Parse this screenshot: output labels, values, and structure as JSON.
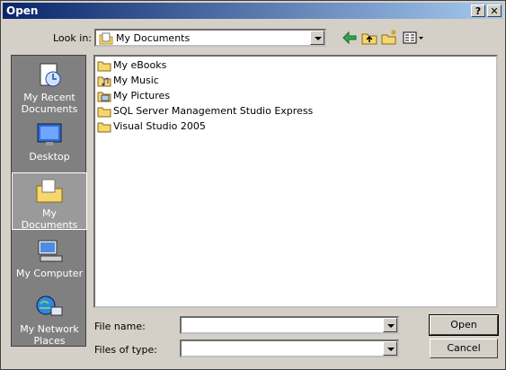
{
  "window": {
    "title": "Open"
  },
  "titlebar": {
    "help": "?",
    "close": "✕"
  },
  "lookin": {
    "label": "Look in:",
    "value": "My Documents",
    "toolbar_icons": [
      "back-arrow-icon",
      "up-folder-icon",
      "new-folder-icon",
      "views-menu-icon"
    ]
  },
  "places": [
    {
      "label": "My Recent Documents",
      "icon": "recent-documents-icon",
      "selected": false
    },
    {
      "label": "Desktop",
      "icon": "desktop-icon",
      "selected": false
    },
    {
      "label": "My Documents",
      "icon": "my-documents-icon",
      "selected": true
    },
    {
      "label": "My Computer",
      "icon": "my-computer-icon",
      "selected": false
    },
    {
      "label": "My Network Places",
      "icon": "network-places-icon",
      "selected": false
    }
  ],
  "files": [
    {
      "name": "My eBooks",
      "icon": "folder-icon"
    },
    {
      "name": "My Music",
      "icon": "music-folder-icon"
    },
    {
      "name": "My Pictures",
      "icon": "pictures-folder-icon"
    },
    {
      "name": "SQL Server Management Studio Express",
      "icon": "folder-icon"
    },
    {
      "name": "Visual Studio 2005",
      "icon": "folder-icon"
    }
  ],
  "bottom": {
    "file_name_label": "File name:",
    "file_name_value": "",
    "file_type_label": "Files of type:",
    "file_type_value": "",
    "open_label": "Open",
    "cancel_label": "Cancel"
  }
}
